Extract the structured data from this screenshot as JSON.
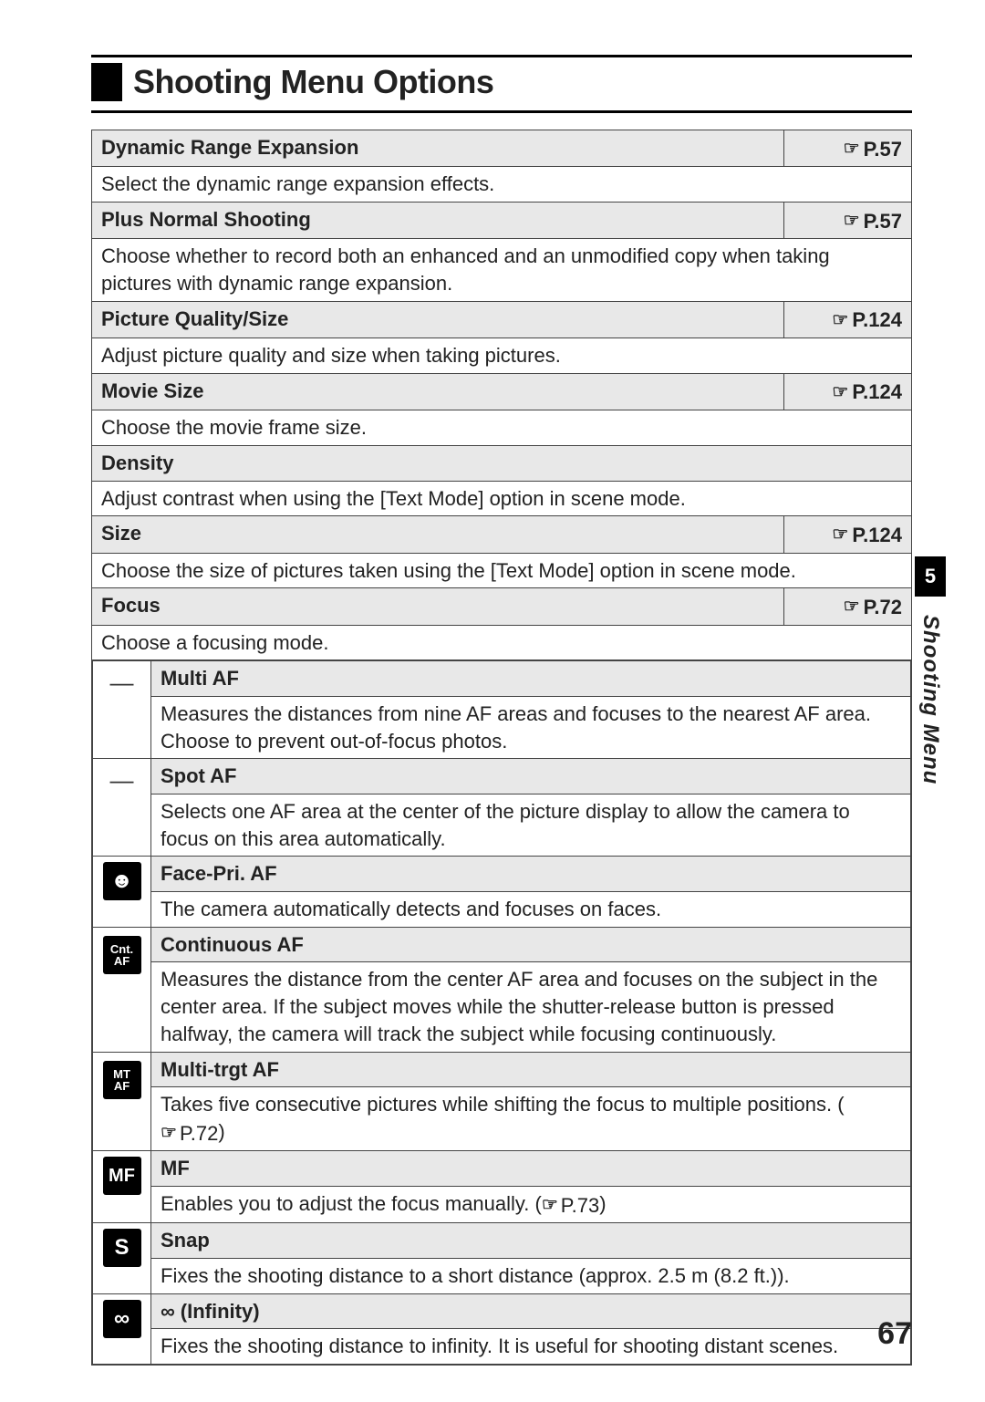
{
  "header": {
    "title": "Shooting Menu Options"
  },
  "sidebar": {
    "chapter": "5",
    "label": "Shooting Menu"
  },
  "page_number": "67",
  "ref_icon": "☞",
  "rows": [
    {
      "title": "Dynamic Range Expansion",
      "ref": "P.57",
      "desc": "Select the dynamic range expansion effects."
    },
    {
      "title": "Plus Normal Shooting",
      "ref": "P.57",
      "desc": "Choose whether to record both an enhanced and an unmodified copy when taking pictures with dynamic range expansion."
    },
    {
      "title": "Picture Quality/Size",
      "ref": "P.124",
      "desc": "Adjust picture quality and size when taking pictures."
    },
    {
      "title": "Movie Size",
      "ref": "P.124",
      "desc": "Choose the movie frame size."
    },
    {
      "title": "Density",
      "ref": "",
      "desc": "Adjust contrast when using the [Text Mode] option in scene mode."
    },
    {
      "title": "Size",
      "ref": "P.124",
      "desc": "Choose the size of pictures taken using the [Text Mode] option in scene mode."
    },
    {
      "title": "Focus",
      "ref": "P.72",
      "desc": "Choose a focusing mode."
    }
  ],
  "focus_modes": [
    {
      "icon_type": "dash",
      "icon": "—",
      "name": "Multi AF",
      "desc": "Measures the distances from nine AF areas and focuses to the nearest AF area. Choose to prevent out-of-focus photos."
    },
    {
      "icon_type": "dash",
      "icon": "—",
      "name": "Spot AF",
      "desc": "Selects one AF area at the center of the picture display to allow the camera to focus on this area automatically."
    },
    {
      "icon_type": "face",
      "icon": "☻",
      "name": "Face-Pri. AF",
      "desc": "The camera automatically detects and focuses on faces."
    },
    {
      "icon_type": "cntaf",
      "icon_t": "Cnt.",
      "icon_b": "AF",
      "name": "Continuous AF",
      "desc": "Measures the distance from the center AF area and focuses on the subject in the center area. If the subject moves while the shutter-release button is pressed halfway, the camera will track the subject while focusing continuously."
    },
    {
      "icon_type": "mtaf",
      "icon_t": "MT",
      "icon_b": "AF",
      "name": "Multi-trgt AF",
      "desc_pre": "Takes five consecutive pictures while shifting the focus to multiple positions. (",
      "desc_ref": "P.72",
      "desc_post": ")"
    },
    {
      "icon_type": "mf",
      "icon": "MF",
      "name": "MF",
      "desc_pre": "Enables you to adjust the focus manually. (",
      "desc_ref": "P.73",
      "desc_post": ")"
    },
    {
      "icon_type": "s",
      "icon": "S",
      "name": "Snap",
      "desc": "Fixes the shooting distance to a short distance (approx. 2.5 m (8.2 ft.))."
    },
    {
      "icon_type": "inf",
      "icon": "∞",
      "name": "∞ (Infinity)",
      "desc": "Fixes the shooting distance to infinity. It is useful for shooting distant scenes."
    }
  ]
}
